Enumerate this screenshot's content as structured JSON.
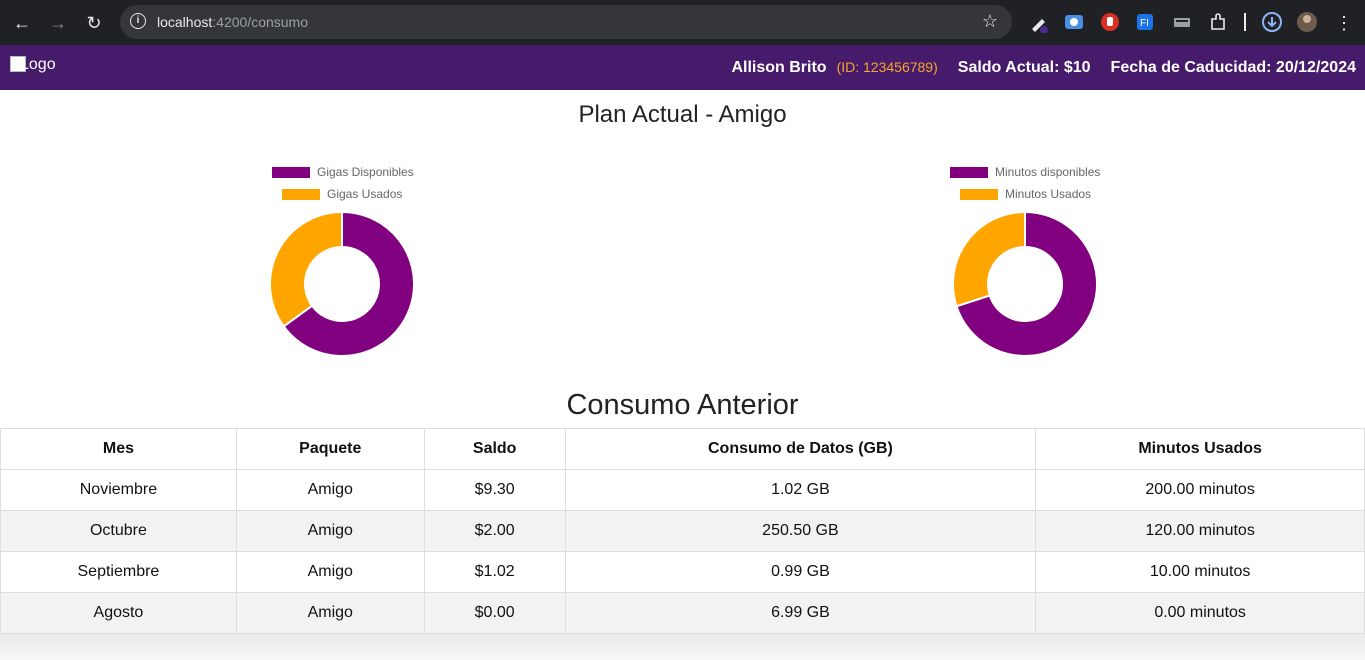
{
  "browser": {
    "url_host": "localhost",
    "url_path": ":4200/consumo",
    "icons": [
      "back-arrow-icon",
      "forward-arrow-icon",
      "reload-icon",
      "site-info-icon",
      "bookmark-star-icon",
      "extensions-puzzle-icon",
      "download-icon",
      "profile-avatar-icon",
      "menu-dots-icon"
    ]
  },
  "header": {
    "logo_alt": "Logo",
    "user_name": "Allison Brito",
    "user_id": "(ID: 123456789)",
    "balance": "Saldo Actual: $10",
    "expiry": "Fecha de Caducidad: 20/12/2024",
    "background_color": "#461b6b",
    "accent_color": "#f6a62b"
  },
  "plan_title": "Plan Actual - Amigo",
  "charts": {
    "data_chart": {
      "legend": [
        "Gigas Disponibles",
        "Gigas Usados"
      ]
    },
    "minutes_chart": {
      "legend": [
        "Minutos disponibles",
        "Minutos Usados"
      ]
    }
  },
  "chart_data": [
    {
      "type": "pie",
      "labels": [
        "Gigas Disponibles",
        "Gigas Usados"
      ],
      "values": [
        65,
        35
      ],
      "colors": [
        "#800080",
        "#ffa500"
      ],
      "donut": true,
      "legend_position": "top"
    },
    {
      "type": "pie",
      "labels": [
        "Minutos disponibles",
        "Minutos Usados"
      ],
      "values": [
        70,
        30
      ],
      "colors": [
        "#800080",
        "#ffa500"
      ],
      "donut": true,
      "legend_position": "top"
    }
  ],
  "history_title": "Consumo Anterior",
  "table": {
    "headers": [
      "Mes",
      "Paquete",
      "Saldo",
      "Consumo de Datos (GB)",
      "Minutos Usados"
    ],
    "rows": [
      [
        "Noviembre",
        "Amigo",
        "$9.30",
        "1.02 GB",
        "200.00 minutos"
      ],
      [
        "Octubre",
        "Amigo",
        "$2.00",
        "250.50 GB",
        "120.00 minutos"
      ],
      [
        "Septiembre",
        "Amigo",
        "$1.02",
        "0.99 GB",
        "10.00 minutos"
      ],
      [
        "Agosto",
        "Amigo",
        "$0.00",
        "6.99 GB",
        "0.00 minutos"
      ]
    ]
  }
}
